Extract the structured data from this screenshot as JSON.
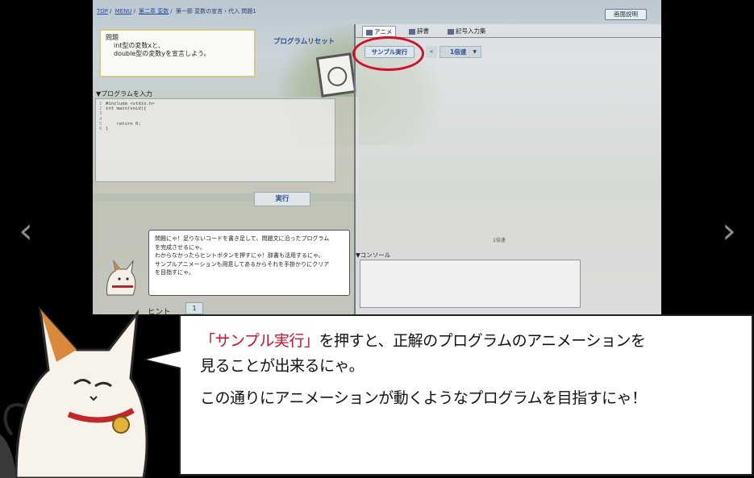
{
  "nav": {
    "prev_icon": "‹",
    "next_icon": "›"
  },
  "app": {
    "breadcrumb": [
      "TOP",
      "MENU",
      "第二章 変数",
      "第一節 変数の宣言・代入 問題1"
    ],
    "help_label": "画面説明",
    "problem": {
      "title": "問題",
      "lines": [
        "int型の変数xと、",
        "double型の変数yを宣言しよう。"
      ]
    },
    "reset_label": "プログラムリセット",
    "editor_label": "▼プログラムを入力",
    "code_lines": [
      "#include <stdio.h>",
      "int main(void){",
      "",
      "",
      "    return 0;",
      "}"
    ],
    "run_label": "実行",
    "hint_text": [
      "問題にゃ！足りないコードを書き足して、問題文に沿ったプログラム",
      "を完成させるにゃ。",
      "わからなかったらヒントボタンを押すにゃ！辞書も活用するにゃ。",
      "サンプルアニメーションも用意してあるからそれを手掛かりにクリア",
      "を目指すにゃ。"
    ],
    "hint_label": "ヒント",
    "hint_number": "1",
    "tabs": {
      "anime": "アニメ",
      "dict": "辞書",
      "symbol": "記号入力集"
    },
    "sample_label": "サンプル実行",
    "speed_prev": "«",
    "speed_value": "1倍速",
    "speed_caret": "▼",
    "speed_caption": "1倍速",
    "console_label": "▼コンソール"
  },
  "speech": {
    "highlight": "「サンプル実行」",
    "line1_rest": "を押すと、正解のプログラムのアニメーションを",
    "line2": "見ることが出来るにゃ。",
    "line3": "この通りにアニメーションが動くようなプログラムを目指すにゃ！"
  },
  "colors": {
    "accent_red": "#d1102a",
    "button_blue": "#2b4f8d"
  }
}
